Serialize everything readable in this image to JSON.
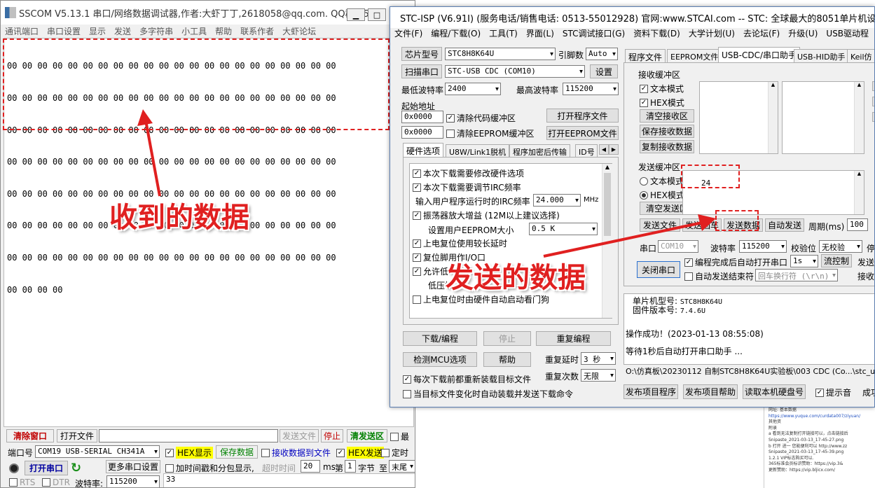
{
  "sscom": {
    "title": "SSCOM V5.13.1 串口/网络数据调试器,作者:大虾丁丁,2618058@qq.com. QQ群：5...",
    "menu": [
      "通讯端口",
      "串口设置",
      "显示",
      "发送",
      "多字符串",
      "小工具",
      "帮助",
      "联系作者",
      "大虾论坛"
    ],
    "receive_lines": [
      "00 00 00 00 00 00 00 00 00 00 00 00 00 00 00 00 00 00 00 00 00 00",
      "00 00 00 00 00 00 00 00 00 00 00 00 00 00 00 00 00 00 00 00 00 00",
      "00 00 00 00 00 00 00 00 00 00 00 00 00 00 00 00 00 00 00 00 00 00",
      "00 00 00 00 00 00 00 00 00 00 00 00 00 00 00 00 00 00 00 00 00 00",
      "00 00 00 00 00 00 00 00 00 00 00 00 00 00 00 00 00 00 00 00 00 00",
      "00 00 00 00 00 00 00 00 00 00 00 00 00 00 00 00 00 00 00 00 00 00",
      "00 00 00 00 00 00 00 00 00 00 00 00 00 00 00 00 00 00 00 00 00 00",
      "00 00 00 00"
    ],
    "annotation_received": "收到的数据",
    "btn_clear_window": "清除窗口",
    "btn_open_file": "打开文件",
    "btn_send_file": "发送文件",
    "btn_stop": "停止",
    "btn_clear_send": "清发送区",
    "chk_last": "最",
    "port_label": "端口号",
    "port_value": "COM19 USB-SERIAL CH341A",
    "chk_hex_display": "HEX显示",
    "btn_save_data": "保存数据",
    "chk_recv_to_file": "接收数据到文件",
    "chk_hex_send": "HEX发送",
    "chk_timed": "定时",
    "btn_open_port": "打开串口",
    "btn_more_settings": "更多串口设置",
    "chk_timestamp": "加时间戳和分包显示,",
    "timeout_label": "超时时间",
    "timeout_value": "20",
    "ms_label": "ms",
    "nth_label": "第",
    "nth_value": "1",
    "byte_label": "字节",
    "to_label": "至",
    "to_value": "末尾",
    "rts_label": "RTS",
    "dtr_label": "DTR",
    "baud_label": "波特率:",
    "baud_value": "115200",
    "send_text": "33"
  },
  "stcisp": {
    "title": "STC-ISP (V6.91I) (服务电话/销售电话: 0513-55012928) 官网:www.STCAI.com  -- STC: 全球最大的8051单片机设计公司 (始",
    "menu": [
      "文件(F)",
      "编程/下载(O)",
      "工具(T)",
      "界面(L)",
      "STC调试接口(G)",
      "资料下载(D)",
      "大学计划(U)",
      "去论坛(F)",
      "升级(U)",
      "USB驱动程"
    ],
    "chip_label": "芯片型号",
    "chip_value": "STC8H8K64U",
    "pins_label": "引脚数",
    "pins_value": "Auto",
    "scan_label": "扫描串口",
    "port_value": "STC-USB CDC (COM10)",
    "settings_label": "设置",
    "min_baud_label": "最低波特率",
    "min_baud_value": "2400",
    "max_baud_label": "最高波特率",
    "max_baud_value": "115200",
    "start_addr_label": "起始地址",
    "addr1": "0x0000",
    "chk_clear_code": "清除代码缓冲区",
    "btn_open_program": "打开程序文件",
    "addr2": "0x0000",
    "chk_clear_eeprom": "清除EEPROM缓冲区",
    "btn_open_eeprom": "打开EEPROM文件",
    "left_tabs": [
      "硬件选项",
      "U8W/Link1脱机",
      "程序加密后传输",
      "ID号"
    ],
    "opt1": "本次下载需要修改硬件选项",
    "opt2": "本次下载需要调节IRC频率",
    "irc_label": "输入用户程序运行时的IRC频率",
    "irc_value": "24.000",
    "irc_unit": "MHz",
    "opt3": "振荡器放大增益 (12M以上建议选择)",
    "eeprom_label": "设置用户EEPROM大小",
    "eeprom_value": "0.5 K",
    "opt4": "上电复位使用较长延时",
    "opt5": "复位脚用作I/O口",
    "opt6": "允许低",
    "opt7": "低压检",
    "opt8": "上电复位时由硬件自动启动看门狗",
    "btn_download": "下载/编程",
    "btn_stop": "停止",
    "btn_reprogram": "重复编程",
    "btn_detect_mcu": "检测MCU选项",
    "btn_help": "帮助",
    "repeat_delay_label": "重复延时",
    "repeat_delay_value": "3 秒",
    "repeat_count_label": "重复次数",
    "repeat_count_value": "无限",
    "chk_reload": "每次下载前都重新装载目标文件",
    "chk_auto_load": "当目标文件变化时自动装载并发送下载命令",
    "right_tabs": [
      "程序文件",
      "EEPROM文件",
      "USB-CDC/串口助手",
      "USB-HID助手",
      "Keil仿"
    ],
    "recv_group": "接收缓冲区",
    "recv_text_mode": "文本模式",
    "recv_hex_mode": "HEX模式",
    "btn_clear_recv": "清空接收区",
    "btn_save_recv": "保存接收数据",
    "btn_copy_recv": "复制接收数据",
    "send_group": "发送缓冲区",
    "send_text_mode": "文本模式",
    "send_hex_mode": "HEX模式",
    "btn_clear_send": "清空发送区",
    "send_value": "24",
    "btn_send_file": "发送文件",
    "btn_send_return": "发送回车",
    "btn_send_data": "发送数据",
    "btn_auto_send": "自动发送",
    "period_label": "周期(ms)",
    "period_value": "100",
    "port_label": "串口",
    "port_com": "COM10",
    "baud_label": "波特率",
    "baud_value": "115200",
    "parity_label": "校验位",
    "parity_value": "无校验",
    "stop_label": "停",
    "btn_close_port": "关闭串口",
    "chk_open_after_program": "编程完成后自动打开串口",
    "delay_value": "1s",
    "btn_flow": "流控制",
    "send_cut": "发送",
    "chk_auto_send_end": "自动发送结束符",
    "end_char_value": "回车换行符 (\\r\\n)",
    "recv_cut": "接收",
    "mcu_model_label": "单片机型号:",
    "mcu_model_value": "STC8H8K64U",
    "fw_label": "固件版本号:",
    "fw_value": "7.4.6U",
    "success_msg": "操作成功！(2023-01-13 08:55:08)",
    "wait_msg": "等待1秒后自动打开串口助手 ...",
    "path": "O:\\仿真板\\20230112 自制STC8H8K64U实验板\\003 CDC (Co...\\stc_us",
    "btn_publish_program": "发布项目程序",
    "btn_publish_help": "发布项目帮助",
    "btn_read_disk": "读取本机硬盘号",
    "chk_sound": "提示音",
    "success_cut": "成功",
    "annotation_sent": "发送的数据"
  },
  "background_doc": [
    "网址: 基本数据 ",
    "https://www.yuque.com/curdata007/ziyuan/",
    "",
    "其他资",
    "附录",
    "a 看到无法复制打开链接可以，点击链接后",
    "Snipaste_2021-03-13_17-45-27.png",
    "b 打开 进一 您能便利可以   http://www.zz",
    "Snipaste_2021-03-13_17-45-39.png",
    "1.2.1 VIP标志购买可以.",
    "365标准会员标识赞助：https://vip.3&",
    "更新赞助：https://vip.bljicx.com/"
  ]
}
